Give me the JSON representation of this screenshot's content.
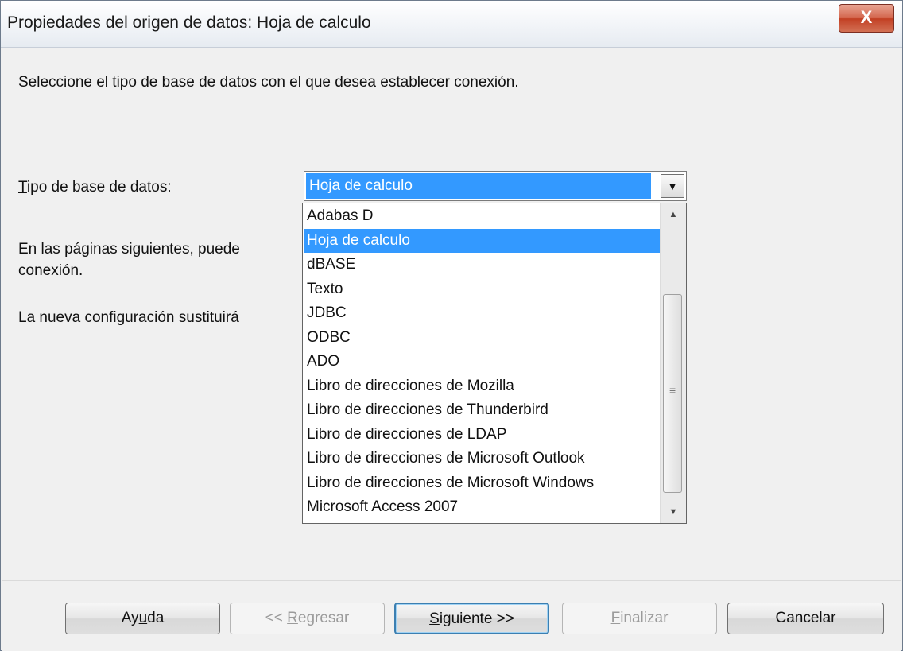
{
  "window": {
    "title": "Propiedades del origen de datos: Hoja de calculo",
    "close_label": "X"
  },
  "main": {
    "instruction": "Seleccione el tipo de base de datos con el que desea establecer conexión.",
    "type_label": "Tipo de base de datos:",
    "info_line1": "En las páginas siguientes, puede",
    "info_line2": "conexión.",
    "replace_text": "La nueva configuración sustituirá"
  },
  "combo": {
    "selected": "Hoja de calculo",
    "options": [
      "Adabas D",
      "Hoja de calculo",
      "dBASE",
      "Texto",
      "JDBC",
      "ODBC",
      "ADO",
      "Libro de direcciones de Mozilla",
      "Libro de direcciones de Thunderbird",
      "Libro de direcciones de LDAP",
      "Libro de direcciones de Microsoft Outlook",
      "Libro de direcciones de Microsoft Windows",
      "Microsoft Access 2007"
    ],
    "highlighted_index": 1
  },
  "buttons": {
    "help": "Ayuda",
    "back": "<< Regresar",
    "next": "Siguiente >>",
    "finish": "Finalizar",
    "cancel": "Cancelar"
  },
  "colors": {
    "selection": "#3399ff",
    "close_button": "#c23f22"
  }
}
